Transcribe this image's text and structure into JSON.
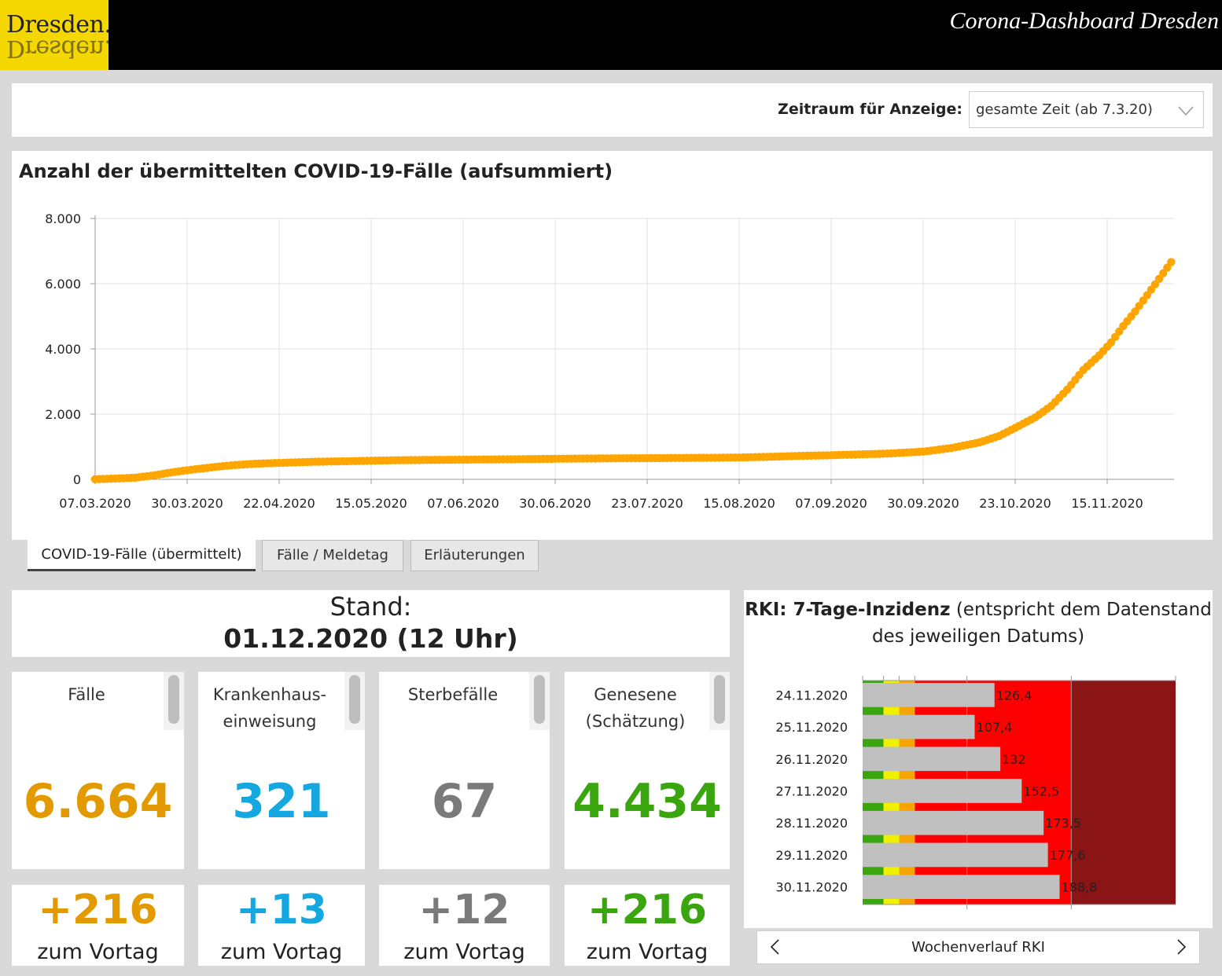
{
  "header": {
    "logo_text": "Dresden.",
    "title": "Corona-Dashboard Dresden"
  },
  "filter": {
    "label": "Zeitraum für Anzeige:",
    "selected": "gesamte Zeit (ab 7.3.20)"
  },
  "main_chart": {
    "title": "Anzahl der übermittelten COVID-19-Fälle (aufsummiert)"
  },
  "tabs": [
    {
      "label": "COVID-19-Fälle (übermittelt)",
      "active": true
    },
    {
      "label": "Fälle / Meldetag",
      "active": false
    },
    {
      "label": "Erläuterungen",
      "active": false
    }
  ],
  "stand": {
    "label": "Stand:",
    "date": "01.12.2020 (12 Uhr)"
  },
  "stats": [
    {
      "label": "Fälle",
      "value": "6.664",
      "delta": "+216",
      "delta_label": "zum Vortag",
      "color": "#e39a00"
    },
    {
      "label": "Krankenhaus-\neinweisung",
      "value": "321",
      "delta": "+13",
      "delta_label": "zum Vortag",
      "color": "#14a7e0"
    },
    {
      "label": "Sterbefälle",
      "value": "67",
      "delta": "+12",
      "delta_label": "zum Vortag",
      "color": "#7a7a7a"
    },
    {
      "label": "Genesene\n(Schätzung)",
      "value": "4.434",
      "delta": "+216",
      "delta_label": "zum Vortag",
      "color": "#3aa50f"
    }
  ],
  "rki": {
    "title_bold": "RKI: 7-Tage-Inzidenz",
    "title_rest": " (entspricht dem Datenstand des jeweiligen Datums)",
    "nav_label": "Wochenverlauf RKI",
    "colors": {
      "green": "#3aa50f",
      "yellow": "#f0f000",
      "orange": "#f5a400",
      "red": "#ff0000",
      "darkred": "#8b1414",
      "bar": "#c0c0c0"
    }
  },
  "chart_data": [
    {
      "type": "scatter",
      "title": "Anzahl der übermittelten COVID-19-Fälle (aufsummiert)",
      "color": "#ffa500",
      "x_ticks": [
        "07.03.2020",
        "30.03.2020",
        "22.04.2020",
        "15.05.2020",
        "07.06.2020",
        "30.06.2020",
        "23.07.2020",
        "15.08.2020",
        "07.09.2020",
        "30.09.2020",
        "23.10.2020",
        "15.11.2020"
      ],
      "y_ticks": [
        "0",
        "2.000",
        "4.000",
        "6.000",
        "8.000"
      ],
      "ylim": [
        0,
        8000
      ],
      "x_range": [
        "07.03.2020",
        "01.12.2020"
      ],
      "grid": true,
      "points": [
        [
          "07.03.2020",
          5
        ],
        [
          "12.03.2020",
          25
        ],
        [
          "17.03.2020",
          50
        ],
        [
          "22.03.2020",
          130
        ],
        [
          "27.03.2020",
          230
        ],
        [
          "01.04.2020",
          310
        ],
        [
          "06.04.2020",
          380
        ],
        [
          "11.04.2020",
          440
        ],
        [
          "16.04.2020",
          480
        ],
        [
          "21.04.2020",
          500
        ],
        [
          "26.04.2020",
          520
        ],
        [
          "01.05.2020",
          540
        ],
        [
          "06.05.2020",
          550
        ],
        [
          "11.05.2020",
          560
        ],
        [
          "16.05.2020",
          575
        ],
        [
          "21.05.2020",
          585
        ],
        [
          "26.05.2020",
          592
        ],
        [
          "01.06.2020",
          598
        ],
        [
          "08.06.2020",
          605
        ],
        [
          "15.06.2020",
          612
        ],
        [
          "22.06.2020",
          620
        ],
        [
          "30.06.2020",
          630
        ],
        [
          "07.07.2020",
          638
        ],
        [
          "15.07.2020",
          645
        ],
        [
          "23.07.2020",
          650
        ],
        [
          "31.07.2020",
          655
        ],
        [
          "08.08.2020",
          662
        ],
        [
          "15.08.2020",
          670
        ],
        [
          "22.08.2020",
          690
        ],
        [
          "29.08.2020",
          715
        ],
        [
          "07.09.2020",
          740
        ],
        [
          "14.09.2020",
          765
        ],
        [
          "21.09.2020",
          790
        ],
        [
          "30.09.2020",
          850
        ],
        [
          "07.10.2020",
          960
        ],
        [
          "14.10.2020",
          1130
        ],
        [
          "19.10.2020",
          1330
        ],
        [
          "23.10.2020",
          1580
        ],
        [
          "28.10.2020",
          1900
        ],
        [
          "01.11.2020",
          2250
        ],
        [
          "05.11.2020",
          2750
        ],
        [
          "09.11.2020",
          3350
        ],
        [
          "13.11.2020",
          3800
        ],
        [
          "16.11.2020",
          4200
        ],
        [
          "19.11.2020",
          4700
        ],
        [
          "22.11.2020",
          5150
        ],
        [
          "25.11.2020",
          5650
        ],
        [
          "28.11.2020",
          6150
        ],
        [
          "01.12.2020",
          6664
        ]
      ]
    },
    {
      "type": "bar",
      "title": "RKI: 7-Tage-Inzidenz",
      "categories": [
        "24.11.2020",
        "25.11.2020",
        "26.11.2020",
        "27.11.2020",
        "28.11.2020",
        "29.11.2020",
        "30.11.2020"
      ],
      "values": [
        126.4,
        107.4,
        132,
        152.5,
        173.5,
        177.6,
        188.8
      ],
      "labels": [
        "126,4",
        "107,4",
        "132",
        "152,5",
        "173,5",
        "177,6",
        "188,8"
      ],
      "xlim": [
        0,
        300
      ],
      "bands": [
        [
          0,
          20,
          "#3aa50f"
        ],
        [
          20,
          35,
          "#f0f000"
        ],
        [
          35,
          50,
          "#f5a400"
        ],
        [
          50,
          200,
          "#ff0000"
        ],
        [
          200,
          300,
          "#8b1414"
        ]
      ]
    }
  ]
}
